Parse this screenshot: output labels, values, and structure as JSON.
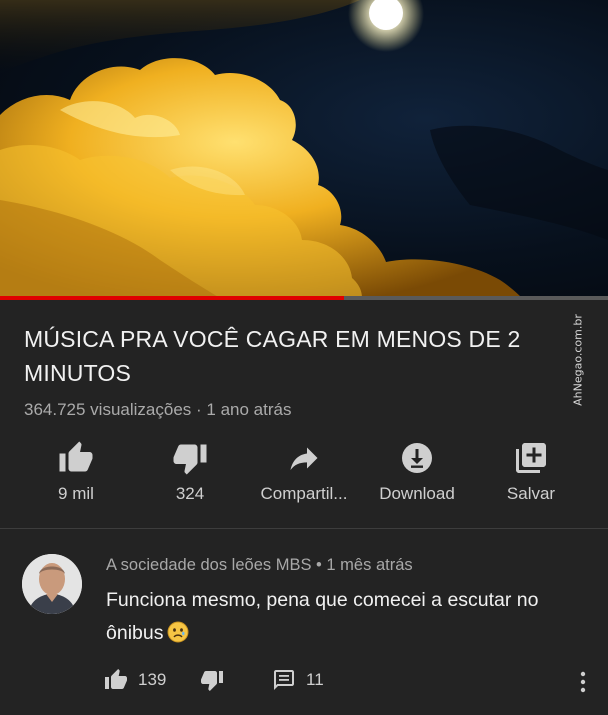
{
  "video": {
    "title": "MÚSICA PRA VOCÊ CAGAR EM MENOS DE 2 MINUTOS",
    "views": "364.725 visualizações",
    "separator": " · ",
    "age": "1 ano atrás",
    "progress_fraction": 0.565
  },
  "watermark": {
    "text": "AhNegao.com.br"
  },
  "actions": {
    "like_count": "9 mil",
    "dislike_count": "324",
    "share_label": "Compartil...",
    "download_label": "Download",
    "save_label": "Salvar"
  },
  "comment": {
    "author": "A sociedade dos leões MBS",
    "separator": " • ",
    "age": "1 mês atrás",
    "text": "Funciona mesmo, pena que comecei a escutar no ônibus",
    "like_count": "139",
    "reply_count": "11"
  },
  "colors": {
    "background": "#232323",
    "progress": "#e00000",
    "secondary_text": "#aaaaaa"
  },
  "icons": [
    "thumb-up-icon",
    "thumb-down-icon",
    "share-arrow-icon",
    "download-icon",
    "playlist-add-icon",
    "reply-icon",
    "more-vert-icon",
    "sad-face-emoji"
  ]
}
